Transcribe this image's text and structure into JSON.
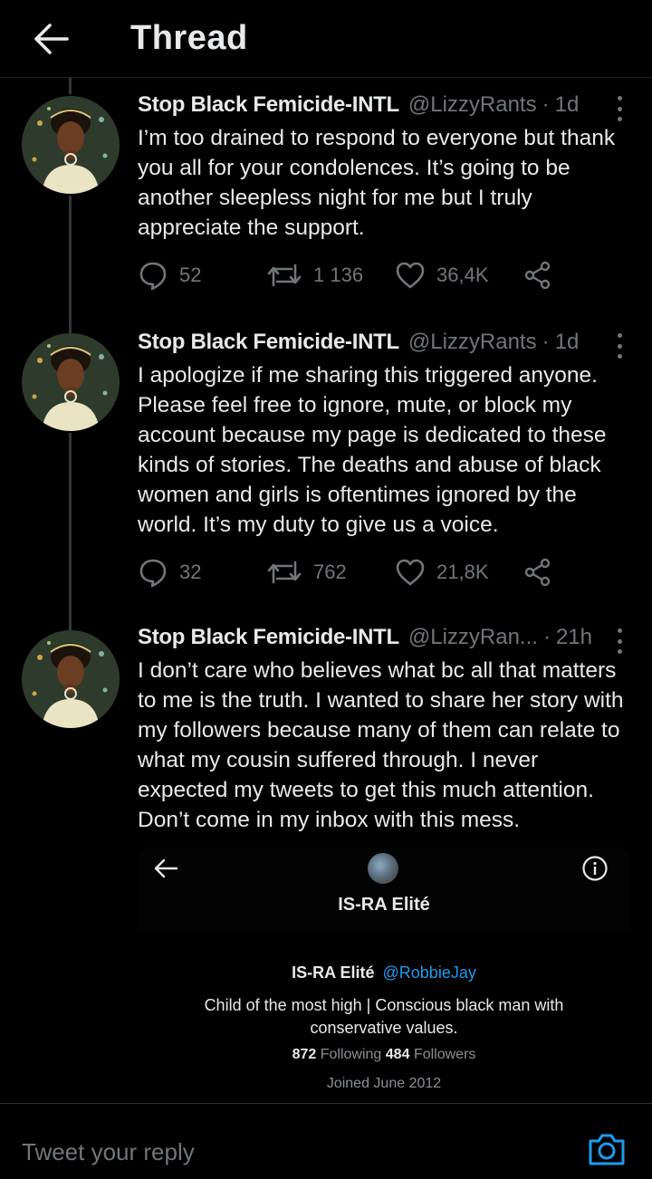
{
  "header": {
    "title": "Thread",
    "back_icon": "arrow-left-icon"
  },
  "tweets": [
    {
      "name": "Stop Black Femicide-INTL",
      "handle": "@LizzyRants",
      "sep": "·",
      "time": "1d",
      "text": "I’m too drained to respond to everyone but thank you all for your condolences. It’s going to be another sleepless night for me but I truly appreciate the support.",
      "replies": "52",
      "retweets": "1 136",
      "likes": "36,4K"
    },
    {
      "name": "Stop Black Femicide-INTL",
      "handle": "@LizzyRants",
      "sep": "·",
      "time": "1d",
      "text": "I apologize if me sharing this triggered anyone. Please feel free to ignore, mute, or block my account because my page is dedicated to these kinds of stories. The deaths and abuse of black women and girls is oftentimes ignored by the world. It’s my duty to give us a voice.",
      "replies": "32",
      "retweets": "762",
      "likes": "21,8K"
    },
    {
      "name": "Stop Black Femicide-INTL",
      "handle": "@LizzyRan...",
      "sep": "·",
      "time": "21h",
      "text": "I don’t care who believes what bc all that matters to me is the truth. I wanted to share her story with my followers because many of them can relate to what my cousin suffered through. I never expected my tweets to get this much attention. Don’t come in my inbox with this mess."
    }
  ],
  "card": {
    "title": "IS-RA Elité",
    "name": "IS-RA Elité",
    "handle": "@RobbieJay",
    "bio": "Child of the most high | Conscious black man with conservative values.",
    "following_count": "872",
    "following_label": "Following",
    "followers_count": "484",
    "followers_label": "Followers",
    "joined": "Joined June 2012"
  },
  "reply": {
    "placeholder": "Tweet your reply"
  },
  "colors": {
    "background": "#000000",
    "text": "#e7e9ea",
    "muted": "#71767b",
    "accent": "#1d9bf0"
  }
}
